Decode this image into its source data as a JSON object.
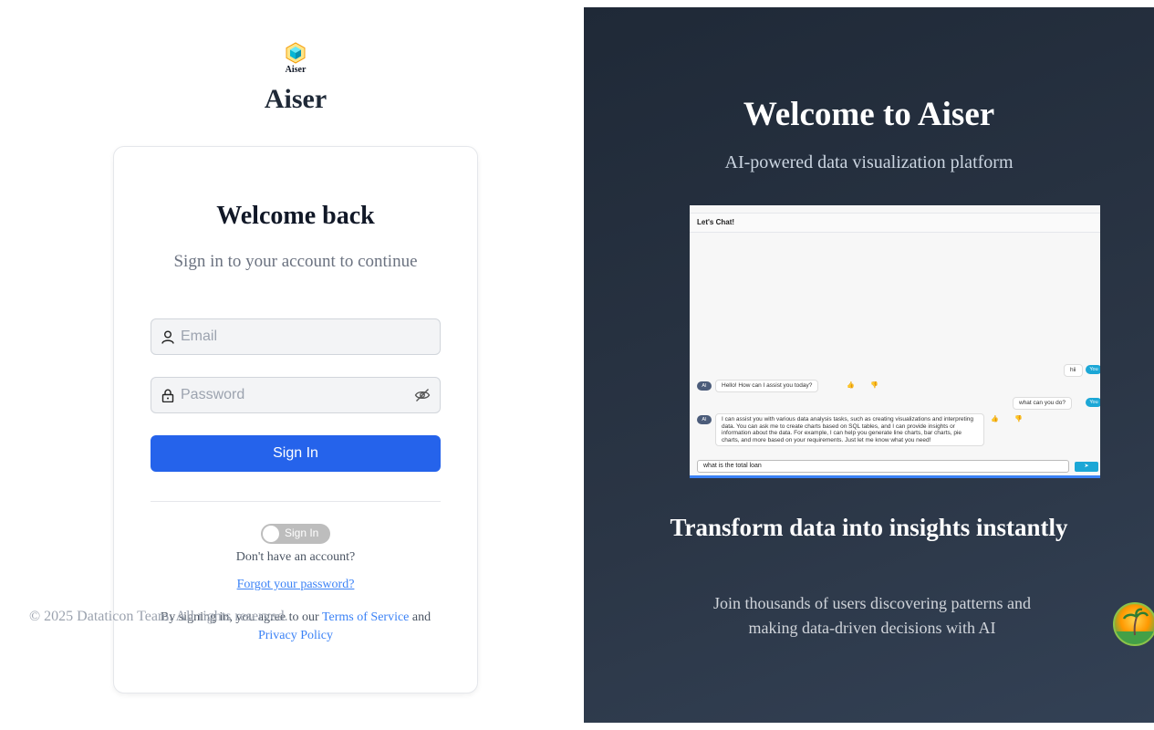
{
  "logo": {
    "icon": "cube-icon",
    "text": "Aiser"
  },
  "brand": "Aiser",
  "login": {
    "title": "Welcome back",
    "subtitle": "Sign in to your account to continue",
    "email_placeholder": "Email",
    "password_placeholder": "Password",
    "signin_label": "Sign In",
    "toggle_label": "Sign In",
    "no_account": "Don't have an account?",
    "forgot": "Forgot your password?",
    "terms_prefix": "By signing in, you agree to our",
    "terms_link": "Terms of Service",
    "terms_and": "and",
    "privacy_link": "Privacy Policy"
  },
  "footer": "© 2025 Dataticon Team. All rights reserved.",
  "hero": {
    "title": "Welcome to Aiser",
    "subtitle": "AI-powered data visualization platform",
    "heading": "Transform data into insights instantly",
    "body": "Join thousands of users discovering patterns and making data-driven decisions with AI"
  },
  "preview": {
    "header": "Let's Chat!",
    "messages": [
      {
        "from": "user",
        "avatar": "You",
        "text": "hii"
      },
      {
        "from": "ai",
        "avatar": "AI",
        "text": "Hello! How can I assist you today?"
      },
      {
        "from": "user",
        "avatar": "You",
        "text": "what can you do?"
      },
      {
        "from": "ai",
        "avatar": "AI",
        "text": "I can assist you with various data analysis tasks, such as creating visualizations and interpreting data. You can ask me to create charts based on SQL tables, and I can provide insights or information about the data. For example, I can help you generate line charts, bar charts, pie charts, and more based on your requirements. Just let me know what you need!"
      }
    ],
    "input_value": "what is the total loan",
    "send_icon": "send-icon"
  },
  "colors": {
    "primary": "#2563eb",
    "panel": "#1f2937",
    "link": "#3b82f6"
  }
}
